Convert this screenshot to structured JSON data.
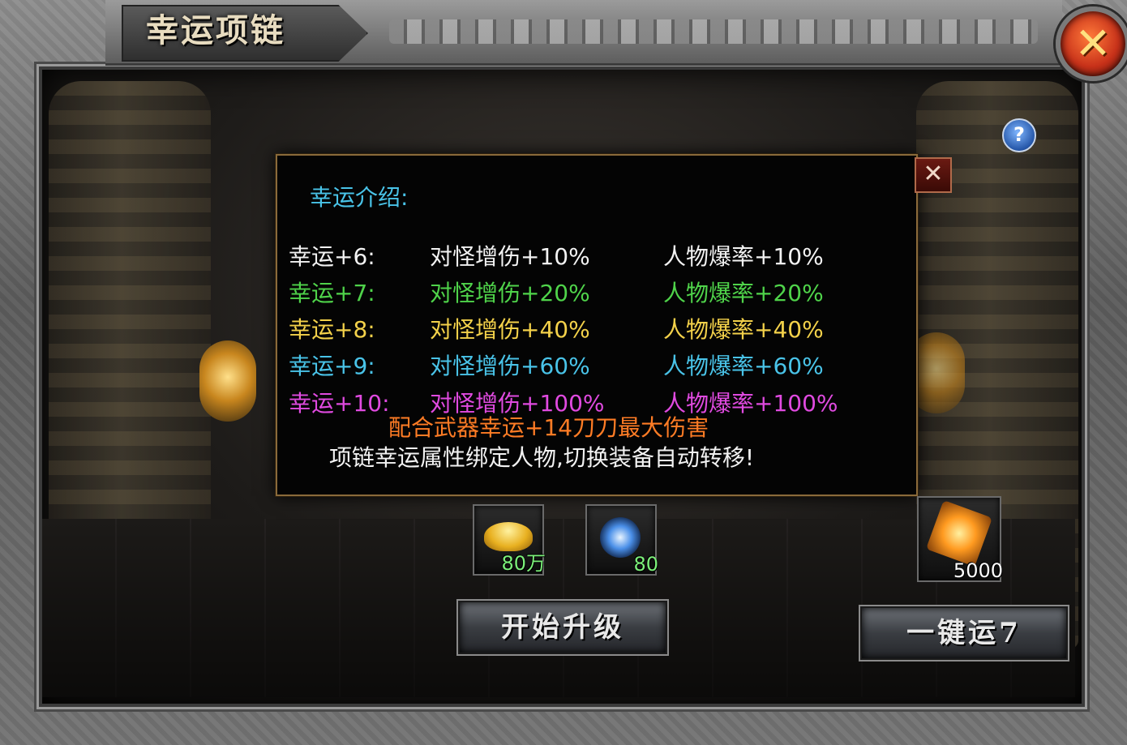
{
  "window": {
    "title": "幸运项链",
    "close_icon": "✕",
    "help_icon": "?"
  },
  "popup": {
    "close_icon": "✕",
    "heading": "幸运介绍:",
    "rows": [
      {
        "level": "幸运+6:",
        "monster_damage": "对怪增伤+10%",
        "drop_rate": "人物爆率+10%",
        "color": "#f2f2f2"
      },
      {
        "level": "幸运+7:",
        "monster_damage": "对怪增伤+20%",
        "drop_rate": "人物爆率+20%",
        "color": "#4fd34a"
      },
      {
        "level": "幸运+8:",
        "monster_damage": "对怪增伤+40%",
        "drop_rate": "人物爆率+40%",
        "color": "#f3d14a"
      },
      {
        "level": "幸运+9:",
        "monster_damage": "对怪增伤+60%",
        "drop_rate": "人物爆率+60%",
        "color": "#49c3e8"
      },
      {
        "level": "幸运+10:",
        "monster_damage": "对怪增伤+100%",
        "drop_rate": "人物爆率+100%",
        "color": "#e04ae0"
      }
    ],
    "note_weapon": "配合武器幸运+14刀刀最大伤害",
    "note_bind": "项链幸运属性绑定人物,切换装备自动转移!"
  },
  "costs": {
    "gold": {
      "icon": "gold-ingot-icon",
      "amount": "80万",
      "color": "#7cf07a"
    },
    "stone": {
      "icon": "blue-orb-icon",
      "amount": "80",
      "color": "#7cf07a"
    }
  },
  "item": {
    "icon": "fire-amulet-icon",
    "amount": "5000",
    "color": "#ffffff"
  },
  "buttons": {
    "upgrade": "开始升级",
    "one_click": "一键运7"
  }
}
